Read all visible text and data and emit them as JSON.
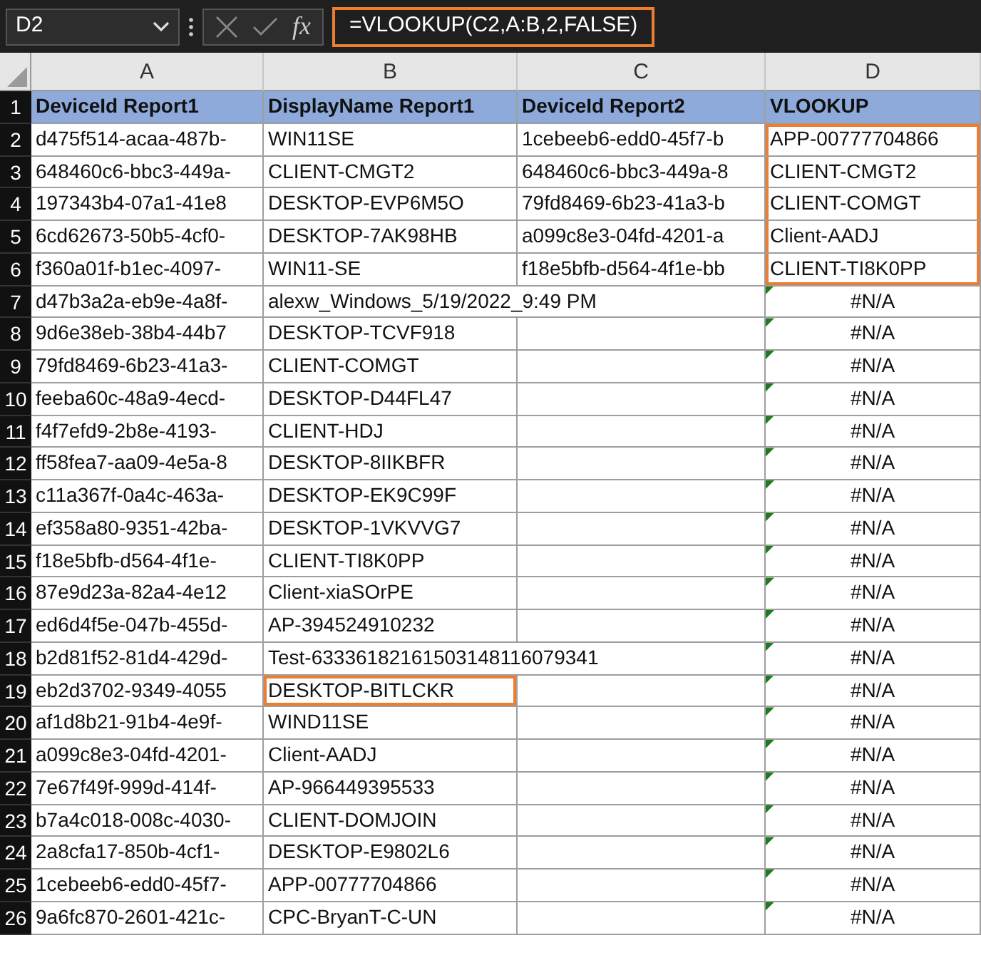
{
  "formula_bar": {
    "name_box": "D2",
    "formula": "=VLOOKUP(C2,A:B,2,FALSE)",
    "formula_highlighted": true,
    "function_label": "fx"
  },
  "columns": [
    "A",
    "B",
    "C",
    "D"
  ],
  "header_row": {
    "number": "1",
    "cells": [
      "DeviceId Report1",
      "DisplayName Report1",
      "DeviceId Report2",
      "VLOOKUP"
    ]
  },
  "rows": [
    {
      "number": "2",
      "device_id_1": "d475f514-acaa-487b-",
      "display_name_1": "WIN11SE",
      "device_id_2": "1cebeeb6-edd0-45f7-b",
      "vlookup": "APP-00777704866",
      "vlookup_error": false,
      "vlookup_highlighted": true,
      "display_name_highlighted": false
    },
    {
      "number": "3",
      "device_id_1": "648460c6-bbc3-449a-",
      "display_name_1": "CLIENT-CMGT2",
      "device_id_2": "648460c6-bbc3-449a-8",
      "vlookup": "CLIENT-CMGT2",
      "vlookup_error": false,
      "vlookup_highlighted": true,
      "display_name_highlighted": false
    },
    {
      "number": "4",
      "device_id_1": "197343b4-07a1-41e8",
      "display_name_1": "DESKTOP-EVP6M5O",
      "device_id_2": "79fd8469-6b23-41a3-b",
      "vlookup": "CLIENT-COMGT",
      "vlookup_error": false,
      "vlookup_highlighted": true,
      "display_name_highlighted": false
    },
    {
      "number": "5",
      "device_id_1": "6cd62673-50b5-4cf0-",
      "display_name_1": "DESKTOP-7AK98HB",
      "device_id_2": "a099c8e3-04fd-4201-a",
      "vlookup": "Client-AADJ",
      "vlookup_error": false,
      "vlookup_highlighted": true,
      "display_name_highlighted": false
    },
    {
      "number": "6",
      "device_id_1": "f360a01f-b1ec-4097-",
      "display_name_1": "WIN11-SE",
      "device_id_2": "f18e5bfb-d564-4f1e-bb",
      "vlookup": "CLIENT-TI8K0PP",
      "vlookup_error": false,
      "vlookup_highlighted": true,
      "display_name_highlighted": false
    },
    {
      "number": "7",
      "device_id_1": "d47b3a2a-eb9e-4a8f-",
      "display_name_1": "alexw_Windows_5/19/2022_9:49 PM",
      "vlookup": "#N/A",
      "vlookup_error": true,
      "vlookup_highlighted": false,
      "display_name_highlighted": false
    },
    {
      "number": "8",
      "device_id_1": "9d6e38eb-38b4-44b7",
      "display_name_1": "DESKTOP-TCVF918",
      "vlookup": "#N/A",
      "vlookup_error": true,
      "vlookup_highlighted": false,
      "display_name_highlighted": false
    },
    {
      "number": "9",
      "device_id_1": "79fd8469-6b23-41a3-",
      "display_name_1": "CLIENT-COMGT",
      "vlookup": "#N/A",
      "vlookup_error": true,
      "vlookup_highlighted": false,
      "display_name_highlighted": false
    },
    {
      "number": "10",
      "device_id_1": "feeba60c-48a9-4ecd-",
      "display_name_1": "DESKTOP-D44FL47",
      "vlookup": "#N/A",
      "vlookup_error": true,
      "vlookup_highlighted": false,
      "display_name_highlighted": false
    },
    {
      "number": "11",
      "device_id_1": "f4f7efd9-2b8e-4193-",
      "display_name_1": "CLIENT-HDJ",
      "vlookup": "#N/A",
      "vlookup_error": true,
      "vlookup_highlighted": false,
      "display_name_highlighted": false
    },
    {
      "number": "12",
      "device_id_1": "ff58fea7-aa09-4e5a-8",
      "display_name_1": "DESKTOP-8IIKBFR",
      "vlookup": "#N/A",
      "vlookup_error": true,
      "vlookup_highlighted": false,
      "display_name_highlighted": false
    },
    {
      "number": "13",
      "device_id_1": "c11a367f-0a4c-463a-",
      "display_name_1": "DESKTOP-EK9C99F",
      "vlookup": "#N/A",
      "vlookup_error": true,
      "vlookup_highlighted": false,
      "display_name_highlighted": false
    },
    {
      "number": "14",
      "device_id_1": "ef358a80-9351-42ba-",
      "display_name_1": "DESKTOP-1VKVVG7",
      "vlookup": "#N/A",
      "vlookup_error": true,
      "vlookup_highlighted": false,
      "display_name_highlighted": false
    },
    {
      "number": "15",
      "device_id_1": "f18e5bfb-d564-4f1e-",
      "display_name_1": "CLIENT-TI8K0PP",
      "vlookup": "#N/A",
      "vlookup_error": true,
      "vlookup_highlighted": false,
      "display_name_highlighted": false
    },
    {
      "number": "16",
      "device_id_1": "87e9d23a-82a4-4e12",
      "display_name_1": "Client-xiaSOrPE",
      "vlookup": "#N/A",
      "vlookup_error": true,
      "vlookup_highlighted": false,
      "display_name_highlighted": false
    },
    {
      "number": "17",
      "device_id_1": "ed6d4f5e-047b-455d-",
      "display_name_1": "AP-394524910232",
      "vlookup": "#N/A",
      "vlookup_error": true,
      "vlookup_highlighted": false,
      "display_name_highlighted": false
    },
    {
      "number": "18",
      "device_id_1": "b2d81f52-81d4-429d-",
      "display_name_1": "Test-63336182161503148116079341",
      "vlookup": "#N/A",
      "vlookup_error": true,
      "vlookup_highlighted": false,
      "display_name_highlighted": false
    },
    {
      "number": "19",
      "device_id_1": "eb2d3702-9349-4055",
      "display_name_1": "DESKTOP-BITLCKR",
      "vlookup": "#N/A",
      "vlookup_error": true,
      "vlookup_highlighted": false,
      "display_name_highlighted": true
    },
    {
      "number": "20",
      "device_id_1": "af1d8b21-91b4-4e9f-",
      "display_name_1": "WIND11SE",
      "vlookup": "#N/A",
      "vlookup_error": true,
      "vlookup_highlighted": false,
      "display_name_highlighted": false
    },
    {
      "number": "21",
      "device_id_1": "a099c8e3-04fd-4201-",
      "display_name_1": "Client-AADJ",
      "vlookup": "#N/A",
      "vlookup_error": true,
      "vlookup_highlighted": false,
      "display_name_highlighted": false
    },
    {
      "number": "22",
      "device_id_1": "7e67f49f-999d-414f-",
      "display_name_1": "AP-966449395533",
      "vlookup": "#N/A",
      "vlookup_error": true,
      "vlookup_highlighted": false,
      "display_name_highlighted": false
    },
    {
      "number": "23",
      "device_id_1": "b7a4c018-008c-4030-",
      "display_name_1": "CLIENT-DOMJOIN",
      "vlookup": "#N/A",
      "vlookup_error": true,
      "vlookup_highlighted": false,
      "display_name_highlighted": false
    },
    {
      "number": "24",
      "device_id_1": "2a8cfa17-850b-4cf1-",
      "display_name_1": "DESKTOP-E9802L6",
      "vlookup": "#N/A",
      "vlookup_error": true,
      "vlookup_highlighted": false,
      "display_name_highlighted": false
    },
    {
      "number": "25",
      "device_id_1": "1cebeeb6-edd0-45f7-",
      "display_name_1": "APP-00777704866",
      "vlookup": "#N/A",
      "vlookup_error": true,
      "vlookup_highlighted": false,
      "display_name_highlighted": false
    },
    {
      "number": "26",
      "device_id_1": "9a6fc870-2601-421c-",
      "display_name_1": "CPC-BryanT-C-UN",
      "vlookup": "#N/A",
      "vlookup_error": true,
      "vlookup_highlighted": false,
      "display_name_highlighted": false
    }
  ]
}
